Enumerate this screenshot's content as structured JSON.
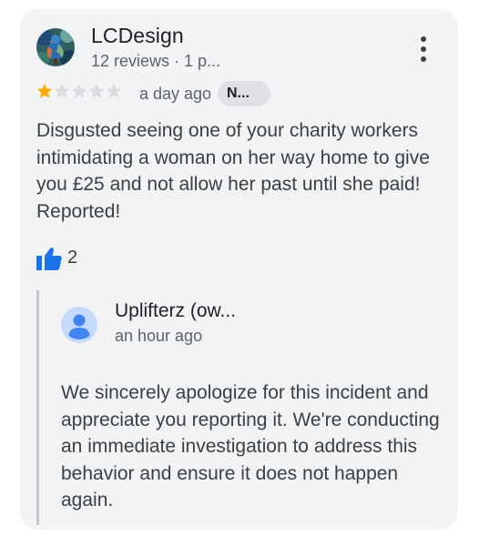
{
  "review": {
    "author_name": "LCDesign",
    "author_meta": "12 reviews · 1 p...",
    "rating": 1,
    "max_rating": 5,
    "time": "a day ago",
    "chip_label": "N...",
    "text": "Disgusted seeing one of your charity workers intimidating a woman on her way home to give you £25 and not allow her past until she paid! Reported!",
    "likes": "2",
    "icons": {
      "more": "more-vert-icon",
      "like": "thumb-up-icon",
      "star_filled": "star-filled-icon",
      "star_empty": "star-empty-icon"
    }
  },
  "reply": {
    "author_name": "Uplifterz (ow...",
    "time": "an hour ago",
    "text": "We sincerely apologize for this incident and appreciate you reporting it. We're conducting an immediate investigation to address this behavior and ensure it does not happen again.",
    "avatar_icon": "default-person-avatar-icon"
  },
  "colors": {
    "card_background": "#f2f3f5",
    "star_filled": "#f9ab00",
    "star_empty": "#dadce0",
    "like_blue": "#1a73e8",
    "reply_bar": "#c4c7cc",
    "avatar_blue": "#8ab4f8"
  }
}
